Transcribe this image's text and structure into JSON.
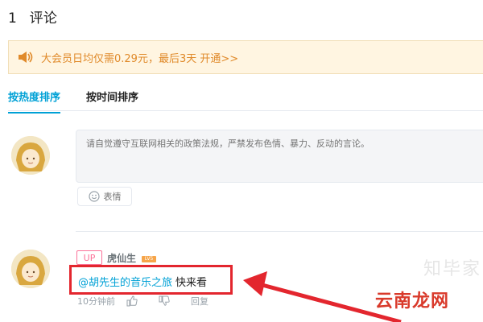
{
  "header": {
    "count": "1",
    "title": "评论"
  },
  "vip_banner": {
    "text": "大会员日均仅需0.29元，最后3天 开通>>"
  },
  "tabs": [
    {
      "label": "按热度排序",
      "active": true
    },
    {
      "label": "按时间排序",
      "active": false
    }
  ],
  "composer": {
    "placeholder": "请自觉遵守互联网相关的政策法规，严禁发布色情、暴力、反动的言论。",
    "emoji_label": "表情"
  },
  "comment": {
    "up_badge": "UP",
    "username": "虎仙生",
    "level": "LV5",
    "mention": "@胡先生的音乐之旅",
    "body": "快来看",
    "time": "10分钟前",
    "reply_label": "回复"
  },
  "watermark": {
    "main": "云南龙网",
    "faded": "知毕家"
  },
  "colors": {
    "accent": "#00a1d6",
    "up_pink": "#fb7299",
    "annotation_red": "#e3262e",
    "banner_bg": "#fff5e1"
  },
  "icons": [
    "speaker-icon",
    "smile-icon",
    "thumbs-up-icon",
    "thumbs-down-icon",
    "arrow-annotation"
  ]
}
